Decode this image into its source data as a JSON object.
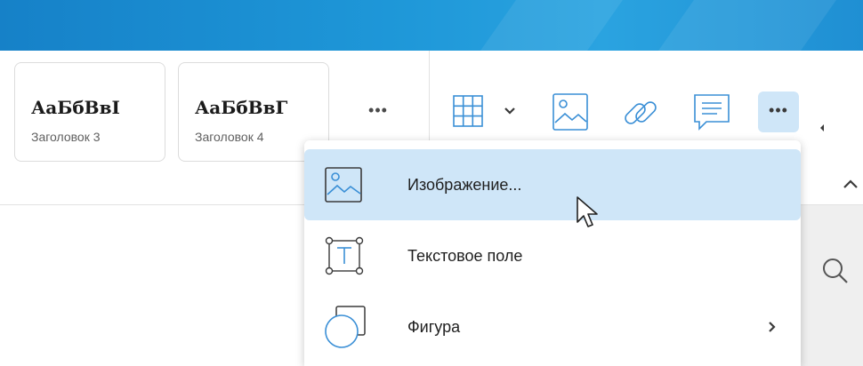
{
  "styles": [
    {
      "preview": "АаБбВвІ",
      "name": "Заголовок 3"
    },
    {
      "preview": "АаБбВвГ",
      "name": "Заголовок 4"
    }
  ],
  "toolbar": {
    "more_styles": "•••",
    "more_insert": "•••",
    "icons": [
      "table-icon",
      "image-icon",
      "link-icon",
      "comment-icon"
    ]
  },
  "insert_menu": {
    "items": [
      {
        "label": "Изображение...",
        "icon": "image-icon",
        "highlighted": true
      },
      {
        "label": "Текстовое поле",
        "icon": "text-box-icon"
      },
      {
        "label": "Фигура",
        "icon": "shape-icon",
        "has_submenu": true
      }
    ]
  },
  "colors": {
    "accent": "#1e97d8",
    "highlight": "#cfe6f8",
    "icon_blue": "#3a8fd6"
  }
}
